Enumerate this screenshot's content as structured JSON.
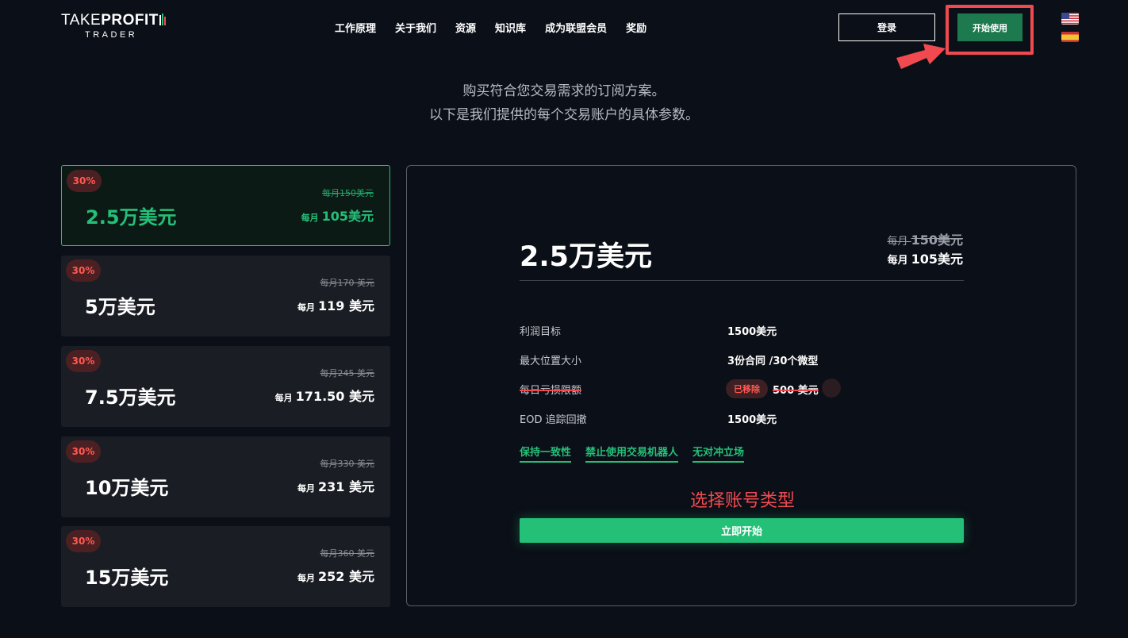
{
  "header": {
    "logo_part1": "TAKE",
    "logo_part2": "PROFIT",
    "logo_sub": "TRADER",
    "nav": [
      "工作原理",
      "关于我们",
      "资源",
      "知识库",
      "成为联盟会员",
      "奖励"
    ],
    "login_label": "登录",
    "start_label": "开始使用"
  },
  "subtitle": {
    "line1": "购买符合您交易需求的订阅方案。",
    "line2": "以下是我们提供的每个交易账户的具体参数。"
  },
  "plans": [
    {
      "badge": "30%",
      "name": "2.5万美元",
      "old_price": "每月150美元",
      "per_month": "每月",
      "new_price": "105美元",
      "selected": true
    },
    {
      "badge": "30%",
      "name": "5万美元",
      "old_price": "每月170 美元",
      "per_month": "每月",
      "new_price": "119 美元",
      "selected": false
    },
    {
      "badge": "30%",
      "name": "7.5万美元",
      "old_price": "每月245 美元",
      "per_month": "每月",
      "new_price": "171.50 美元",
      "selected": false
    },
    {
      "badge": "30%",
      "name": "10万美元",
      "old_price": "每月330 美元",
      "per_month": "每月",
      "new_price": "231 美元",
      "selected": false
    },
    {
      "badge": "30%",
      "name": "15万美元",
      "old_price": "每月360 美元",
      "per_month": "每月",
      "new_price": "252 美元",
      "selected": false
    }
  ],
  "details": {
    "title": "2.5万美元",
    "old_prefix": "每月",
    "old_amount": "150美元",
    "new_prefix": "每月",
    "new_amount": "105美元",
    "rows": [
      {
        "label": "利润目标",
        "value": "1500美元"
      },
      {
        "label": "最大位置大小",
        "value": "3份合同 /30个微型"
      },
      {
        "label": "每日亏损限额",
        "removed_badge": "已移除",
        "value": "500 美元"
      },
      {
        "label": "EOD 追踪回撤",
        "value": "1500美元"
      }
    ],
    "rules": [
      "保持一致性",
      "禁止使用交易机器人",
      "无对冲立场"
    ],
    "annotation": "选择账号类型",
    "cta_label": "立即开始"
  },
  "colors": {
    "accent_green": "#24c078",
    "button_green": "#1d7a4f",
    "highlight_red": "#f04a50",
    "background": "#0b0f17"
  }
}
